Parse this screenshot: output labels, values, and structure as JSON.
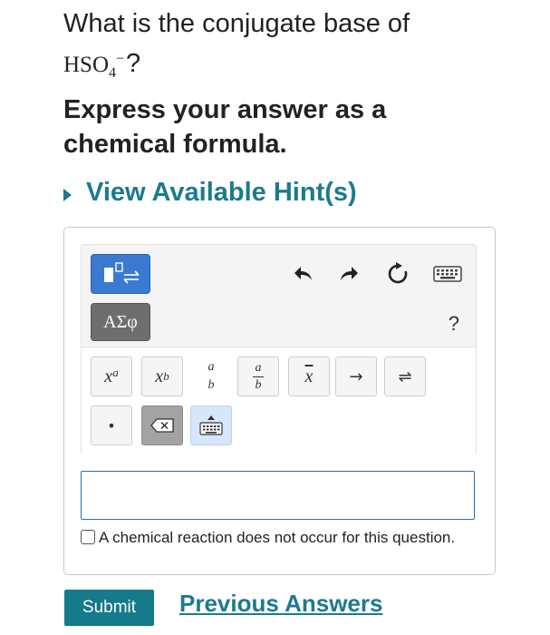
{
  "question": {
    "line1": "What is the conjugate base of",
    "formula_main": "HSO",
    "formula_sub": "4",
    "formula_sup": "−",
    "formula_end": "?"
  },
  "instruction": "Express your answer as a chemical formula.",
  "hint_link": "View Available Hint(s)",
  "toolbar": {
    "greek_label": "ΑΣφ",
    "help_label": "?",
    "undo_icon": "undo-icon",
    "redo_icon": "redo-icon",
    "reset_icon": "reset-icon",
    "keyboard_icon": "keyboard-icon"
  },
  "keys": {
    "superscript_base": "x",
    "superscript_exp": "a",
    "subscript_base": "x",
    "subscript_sub": "b",
    "fraction_num": "a",
    "fraction_den": "b",
    "mixed_num": "a",
    "mixed_den": "b",
    "xbar": "x",
    "arrow": "→",
    "equilibrium": "⇌",
    "dot": "•"
  },
  "answer_input": {
    "value": ""
  },
  "no_reaction_checkbox": {
    "label": "A chemical reaction does not occur for this question.",
    "checked": false
  },
  "submit_label": "Submit",
  "previous_answers_label": "Previous Answers",
  "colors": {
    "link": "#1b7a8f",
    "submit_bg": "#157a8a",
    "template_button": "#3a7ad1",
    "greek_button": "#6e6e6e",
    "answer_border": "#2a6fb5"
  }
}
